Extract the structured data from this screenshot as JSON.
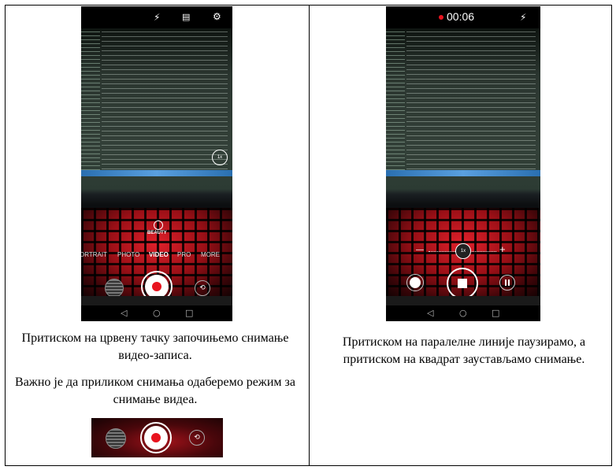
{
  "left_cell": {
    "phone": {
      "modes": [
        "ORTRAIT",
        "PHOTO",
        "VIDEO",
        "PRO",
        "MORE"
      ],
      "beauty_label": "BEAUTY",
      "zoom_label": "1x"
    },
    "caption_1": "Притиском на црвену тачку започињемо снимање видео-записа.",
    "caption_2": "Важно је да приликом снимања одаберемо режим за снимање видеа."
  },
  "right_cell": {
    "phone": {
      "record_time": "00:06",
      "zoom_label": "1x",
      "zoom_minus": "—",
      "zoom_plus": "+"
    },
    "caption": "Притиском на паралелне линије паузирамо, а притиском на квадрат заустављамо снимање."
  },
  "icons": {
    "flash_off": "flash-off-icon",
    "filmstrip": "filmstrip-icon",
    "settings": "gear-icon",
    "back": "back-icon",
    "home": "home-icon",
    "recents": "recents-icon"
  }
}
